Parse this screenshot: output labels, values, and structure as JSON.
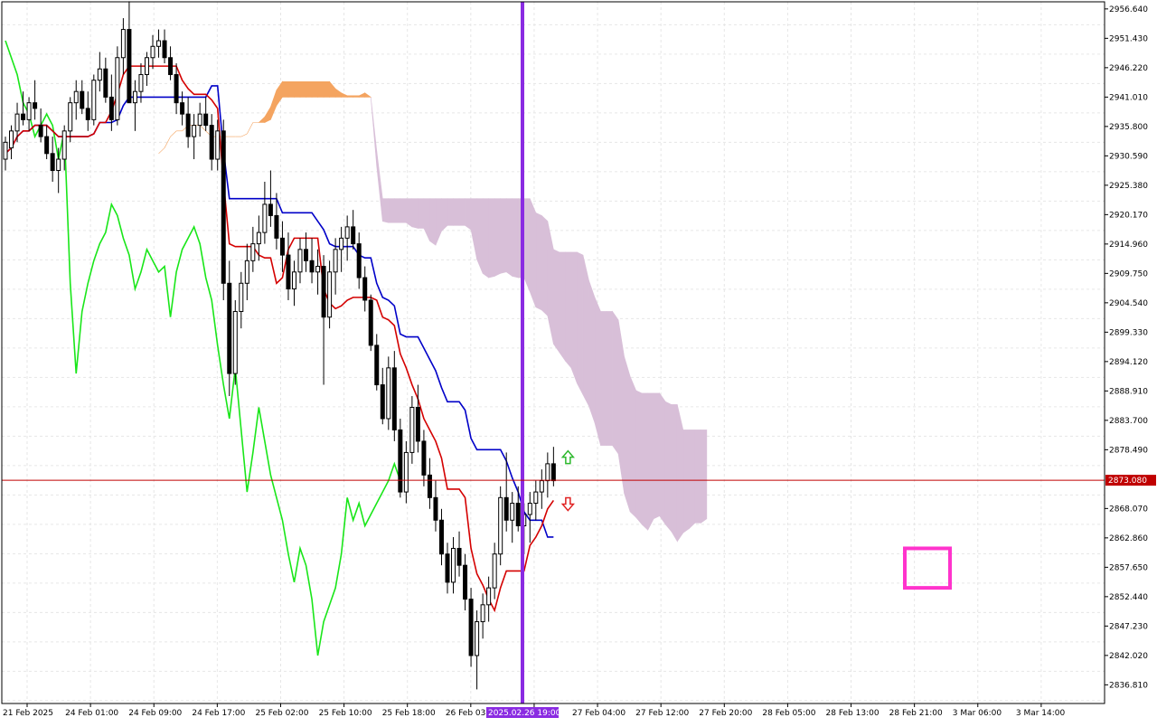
{
  "colors": {
    "background": "#ffffff",
    "grid": "#e6e6e6",
    "axis": "#000000",
    "bull_candle_fill": "#ffffff",
    "bear_candle_fill": "#000000",
    "candle_stroke": "#000000",
    "tenkan": "#d40000",
    "kijun": "#0000c8",
    "chikou": "#19e619",
    "kumo_bull": "#f4a460",
    "kumo_bear": "#d8bfd8",
    "current_price": "#c00000",
    "separator": "#8a2be2",
    "highlight_box": "#ff33cc",
    "arrow_up": "#2db82d",
    "arrow_down": "#e02020"
  },
  "chart_data": {
    "type": "candlestick",
    "y_axis_ticks": [
      "2956.640",
      "2951.430",
      "2946.220",
      "2941.010",
      "2935.800",
      "2930.590",
      "2925.380",
      "2920.170",
      "2914.960",
      "2909.750",
      "2904.540",
      "2899.330",
      "2894.120",
      "2888.910",
      "2883.700",
      "2878.490",
      "2868.070",
      "2862.860",
      "2857.650",
      "2852.440",
      "2847.230",
      "2842.020",
      "2836.810"
    ],
    "x_axis_labels": [
      "21 Feb 2025",
      "24 Feb 01:00",
      "24 Feb 09:00",
      "24 Feb 17:00",
      "25 Feb 02:00",
      "25 Feb 10:00",
      "25 Feb 18:00",
      "26 Feb 03:00",
      "26 Fe",
      "27 Feb 04:00",
      "27 Feb 12:00",
      "27 Feb 20:00",
      "28 Feb 05:00",
      "28 Feb 13:00",
      "28 Feb 21:00",
      "3 Mar 06:00",
      "3 Mar 14:00"
    ],
    "ylim": [
      2833.5,
      2957.9
    ],
    "current_price": 2873.08,
    "current_price_label": "2873.080",
    "separator_label": "2025.02.26 19:00",
    "candles": [
      [
        2930,
        2934,
        2928,
        2933
      ],
      [
        2932,
        2936,
        2930,
        2935
      ],
      [
        2935,
        2940,
        2933,
        2938
      ],
      [
        2938,
        2942,
        2936,
        2937
      ],
      [
        2937,
        2941,
        2935,
        2940
      ],
      [
        2940,
        2944,
        2937,
        2939
      ],
      [
        2936,
        2939,
        2933,
        2934
      ],
      [
        2934,
        2936,
        2930,
        2931
      ],
      [
        2931,
        2934,
        2926,
        2928
      ],
      [
        2928,
        2932,
        2924,
        2930
      ],
      [
        2930,
        2936,
        2928,
        2935
      ],
      [
        2935,
        2941,
        2933,
        2940
      ],
      [
        2940,
        2944,
        2937,
        2942
      ],
      [
        2942,
        2944,
        2938,
        2939
      ],
      [
        2939,
        2942,
        2935,
        2937
      ],
      [
        2937,
        2945,
        2936,
        2944
      ],
      [
        2944,
        2949,
        2942,
        2946
      ],
      [
        2946,
        2948,
        2940,
        2941
      ],
      [
        2941,
        2945,
        2935,
        2937
      ],
      [
        2937,
        2950,
        2936,
        2948
      ],
      [
        2948,
        2955,
        2945,
        2953
      ],
      [
        2953,
        2958,
        2946,
        2940
      ],
      [
        2940,
        2944,
        2935,
        2942
      ],
      [
        2942,
        2947,
        2940,
        2945
      ],
      [
        2945,
        2949,
        2943,
        2948
      ],
      [
        2948,
        2952,
        2946,
        2950
      ],
      [
        2950,
        2953,
        2948,
        2951
      ],
      [
        2951,
        2953,
        2947,
        2948
      ],
      [
        2948,
        2950,
        2944,
        2945
      ],
      [
        2945,
        2947,
        2938,
        2940
      ],
      [
        2940,
        2942,
        2936,
        2938
      ],
      [
        2938,
        2941,
        2932,
        2934
      ],
      [
        2934,
        2938,
        2930,
        2936
      ],
      [
        2936,
        2940,
        2934,
        2938
      ],
      [
        2938,
        2941,
        2935,
        2936
      ],
      [
        2936,
        2938,
        2928,
        2930
      ],
      [
        2930,
        2937,
        2928,
        2935
      ],
      [
        2935,
        2937,
        2905,
        2908
      ],
      [
        2908,
        2912,
        2888,
        2892
      ],
      [
        2892,
        2905,
        2890,
        2903
      ],
      [
        2903,
        2910,
        2900,
        2908
      ],
      [
        2908,
        2915,
        2905,
        2912
      ],
      [
        2912,
        2918,
        2910,
        2915
      ],
      [
        2915,
        2920,
        2912,
        2917
      ],
      [
        2917,
        2926,
        2915,
        2922
      ],
      [
        2922,
        2928,
        2918,
        2920
      ],
      [
        2920,
        2924,
        2914,
        2916
      ],
      [
        2916,
        2919,
        2910,
        2913
      ],
      [
        2913,
        2917,
        2905,
        2907
      ],
      [
        2907,
        2912,
        2904,
        2910
      ],
      [
        2910,
        2916,
        2908,
        2914
      ],
      [
        2914,
        2917,
        2910,
        2912
      ],
      [
        2912,
        2916,
        2908,
        2910
      ],
      [
        2910,
        2914,
        2906,
        2911
      ],
      [
        2911,
        2913,
        2890,
        2902
      ],
      [
        2902,
        2912,
        2900,
        2910
      ],
      [
        2910,
        2916,
        2906,
        2914
      ],
      [
        2914,
        2918,
        2910,
        2916
      ],
      [
        2916,
        2920,
        2912,
        2918
      ],
      [
        2918,
        2921,
        2914,
        2915
      ],
      [
        2915,
        2917,
        2907,
        2909
      ],
      [
        2909,
        2911,
        2903,
        2905
      ],
      [
        2905,
        2906,
        2896,
        2897
      ],
      [
        2897,
        2899,
        2889,
        2890
      ],
      [
        2890,
        2893,
        2883,
        2884
      ],
      [
        2884,
        2895,
        2882,
        2893
      ],
      [
        2893,
        2896,
        2880,
        2882
      ],
      [
        2882,
        2884,
        2870,
        2871
      ],
      [
        2871,
        2880,
        2869,
        2878
      ],
      [
        2878,
        2888,
        2876,
        2886
      ],
      [
        2886,
        2890,
        2878,
        2880
      ],
      [
        2880,
        2882,
        2872,
        2874
      ],
      [
        2874,
        2877,
        2868,
        2870
      ],
      [
        2870,
        2873,
        2864,
        2866
      ],
      [
        2866,
        2868,
        2858,
        2860
      ],
      [
        2860,
        2862,
        2853,
        2855
      ],
      [
        2855,
        2863,
        2853,
        2861
      ],
      [
        2861,
        2864,
        2856,
        2858
      ],
      [
        2858,
        2860,
        2850,
        2852
      ],
      [
        2852,
        2854,
        2840,
        2842
      ],
      [
        2842,
        2850,
        2836,
        2848
      ],
      [
        2848,
        2853,
        2845,
        2851
      ],
      [
        2851,
        2856,
        2848,
        2854
      ],
      [
        2854,
        2862,
        2852,
        2860
      ],
      [
        2860,
        2872,
        2858,
        2870
      ],
      [
        2870,
        2878,
        2864,
        2866
      ],
      [
        2866,
        2871,
        2862,
        2869
      ],
      [
        2869,
        2872,
        2864,
        2865
      ],
      [
        2865,
        2869,
        2860,
        2867
      ],
      [
        2867,
        2871,
        2862,
        2869
      ],
      [
        2869,
        2873,
        2866,
        2871
      ],
      [
        2871,
        2875,
        2868,
        2873
      ],
      [
        2873,
        2878,
        2870,
        2876
      ],
      [
        2876,
        2879,
        2872,
        2873
      ]
    ],
    "kumo_last_index": 121
  }
}
